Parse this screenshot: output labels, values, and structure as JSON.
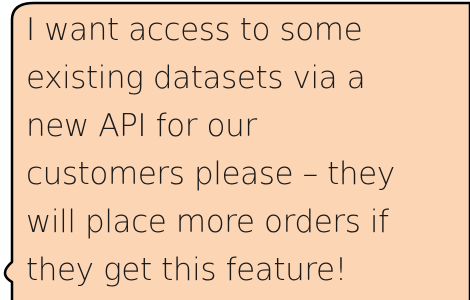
{
  "speech_bubble": {
    "fill_color": "#fcd5b5",
    "outline_color": "#000000",
    "lines": [
      "I want access to some",
      "existing datasets via a",
      "new API for our",
      "customers please – they",
      "will place more orders if",
      "they get this feature!"
    ]
  }
}
